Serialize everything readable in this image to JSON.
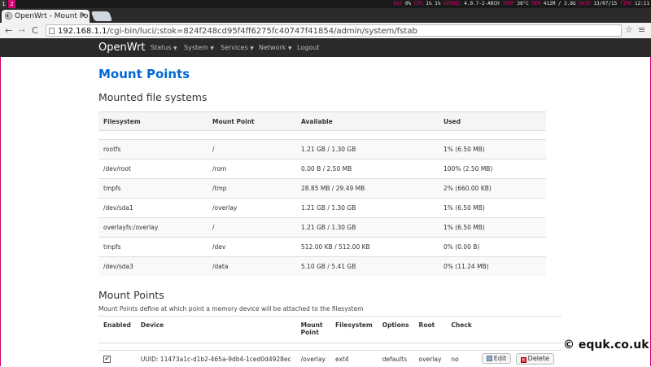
{
  "system_bar": {
    "workspaces": [
      "1",
      "2"
    ],
    "items": [
      {
        "key": "BAT",
        "value": "0%"
      },
      {
        "key": "CPU",
        "value": "1% 1%"
      },
      {
        "key": "KERNEL",
        "value": "4.0.7-2-ARCH"
      },
      {
        "key": "TEMP",
        "value": "38°C"
      },
      {
        "key": "MEM",
        "value": "412M / 3.8G"
      },
      {
        "key": "DATE",
        "value": "13/07/15"
      },
      {
        "key": "TIME",
        "value": "12:11"
      }
    ]
  },
  "browser": {
    "tab_title": "OpenWrt - Mount Po",
    "tab_close": "×",
    "url_host": "192.168.1.1",
    "url_path": "/cgi-bin/luci/;stok=824f248cd95f4ff6275fc40747f41854/admin/system/fstab",
    "back": "←",
    "forward": "→",
    "reload": "C",
    "star": "☆",
    "menu": "≡"
  },
  "header": {
    "brand": "OpenWrt",
    "nav": [
      {
        "label": "Status",
        "dropdown": true
      },
      {
        "label": "System",
        "dropdown": true
      },
      {
        "label": "Services",
        "dropdown": true
      },
      {
        "label": "Network",
        "dropdown": true
      },
      {
        "label": "Logout",
        "dropdown": false
      }
    ]
  },
  "page": {
    "title": "Mount Points",
    "mounted_heading": "Mounted file systems",
    "mounted_columns": [
      "Filesystem",
      "Mount Point",
      "Available",
      "Used"
    ],
    "mounted_rows": [
      [
        "rootfs",
        "/",
        "1.21 GB / 1.30 GB",
        "1% (6.50 MB)"
      ],
      [
        "/dev/root",
        "/rom",
        "0.00 B / 2.50 MB",
        "100% (2.50 MB)"
      ],
      [
        "tmpfs",
        "/tmp",
        "28.85 MB / 29.49 MB",
        "2% (660.00 KB)"
      ],
      [
        "/dev/sda1",
        "/overlay",
        "1.21 GB / 1.30 GB",
        "1% (6.50 MB)"
      ],
      [
        "overlayfs:/overlay",
        "/",
        "1.21 GB / 1.30 GB",
        "1% (6.50 MB)"
      ],
      [
        "tmpfs",
        "/dev",
        "512.00 KB / 512.00 KB",
        "0% (0.00 B)"
      ],
      [
        "/dev/sda3",
        "/data",
        "5.10 GB / 5.41 GB",
        "0% (11.24 MB)"
      ]
    ],
    "mount_points_heading": "Mount Points",
    "mount_points_desc": "Mount Points define at which point a memory device will be attached to the filesystem",
    "mp_columns": [
      "Enabled",
      "Device",
      "Mount Point",
      "Filesystem",
      "Options",
      "Root",
      "Check"
    ],
    "mp_rows": [
      {
        "enabled": "✔",
        "device": "UUID: 11473a1c-d1b2-465a-9db4-1ced0d4928ec",
        "mount_point": "/overlay",
        "filesystem": "ext4",
        "options": "defaults",
        "root": "overlay",
        "check": "no",
        "edit_label": "Edit",
        "delete_label": "Delete"
      }
    ]
  },
  "watermark": "© equk.co.uk"
}
